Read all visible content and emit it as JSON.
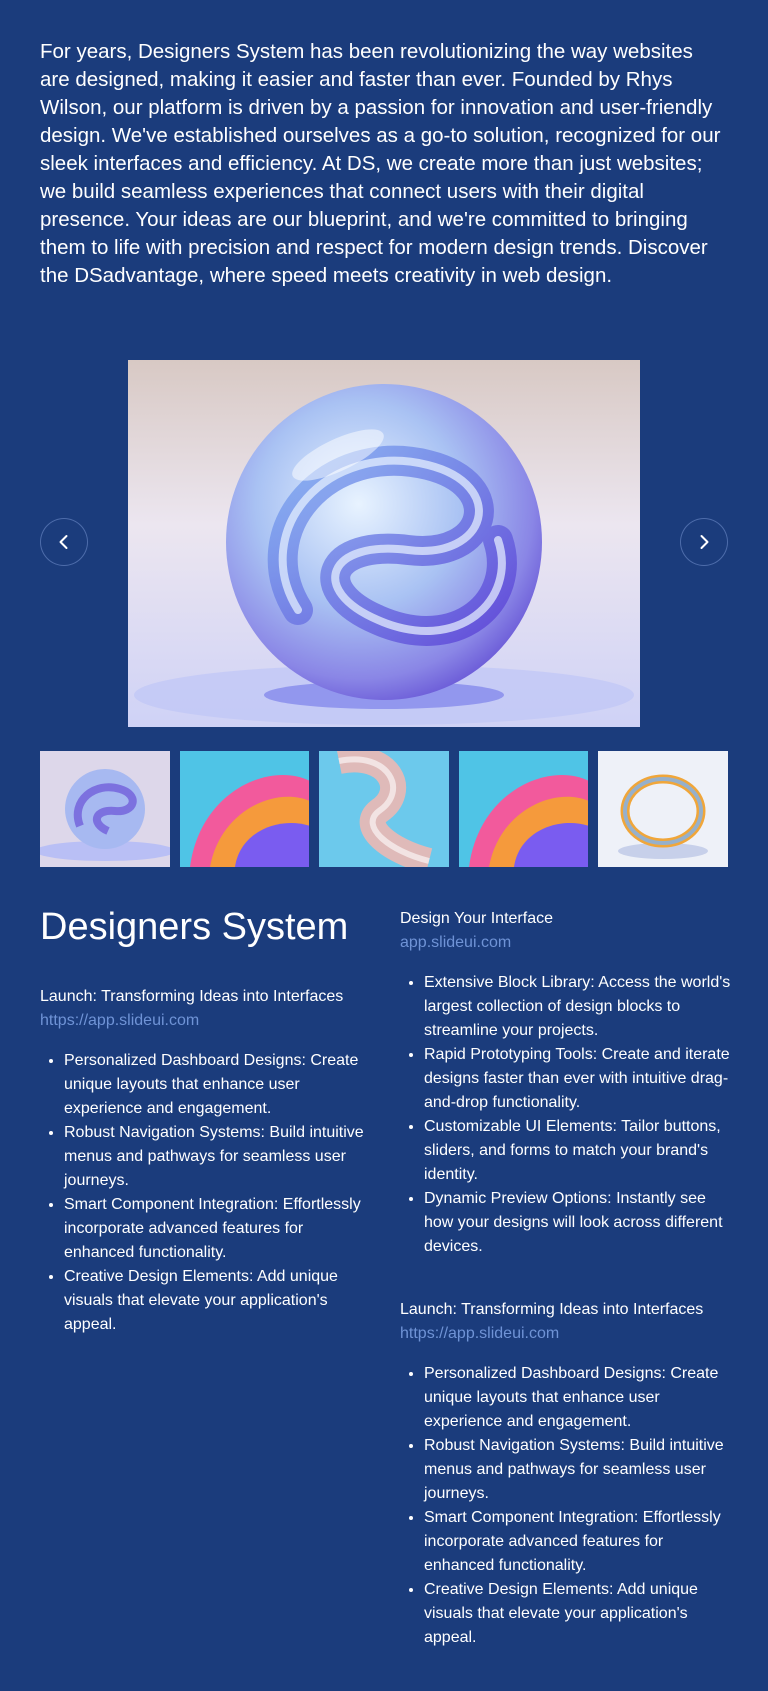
{
  "intro": {
    "text": "For years, Designers System has been revolutionizing the way websites are designed, making it easier and faster than ever. Founded by Rhys Wilson, our platform is driven by a passion for innovation and user-friendly design. We've established ourselves as a go-to solution, recognized for our sleek interfaces and efficiency. At DS, we create more than just websites; we build seamless experiences that connect users with their digital presence. Your ideas are our blueprint, and we're committed to bringing them to life with precision and respect for modern design trends. Discover the DSadvantage, where speed meets creativity in web design."
  },
  "gallery": {
    "prev_icon": "chevron-left-icon",
    "next_icon": "chevron-right-icon",
    "main_image": "glass-sphere-image",
    "thumbnails": [
      "glass-sphere-image",
      "rainbow-wave-image",
      "glass-ribbon-image",
      "rainbow-wave-image",
      "glass-ring-image"
    ]
  },
  "left": {
    "title": "Designers System",
    "block_title": "Launch: Transforming Ideas into Interfaces",
    "block_link": "https://app.slideui.com",
    "items": [
      "Personalized Dashboard Designs: Create unique layouts that enhance user experience and engagement.",
      "Robust Navigation Systems: Build intuitive menus and pathways for seamless user journeys.",
      "Smart Component Integration: Effortlessly incorporate advanced features for enhanced functionality.",
      "Creative Design Elements: Add unique visuals that elevate your application's appeal."
    ]
  },
  "right": {
    "block1_title": "Design Your Interface",
    "block1_link": "app.slideui.com",
    "block1_items": [
      "Extensive Block Library: Access the world's largest collection of design blocks to streamline your projects.",
      "Rapid Prototyping Tools: Create and iterate designs faster than ever with intuitive drag-and-drop functionality.",
      "Customizable UI Elements: Tailor buttons, sliders, and forms to match your brand's identity.",
      "Dynamic Preview Options: Instantly see how your designs will look across different devices."
    ],
    "block2_title": "Launch: Transforming Ideas into Interfaces",
    "block2_link": "https://app.slideui.com",
    "block2_items": [
      "Personalized Dashboard Designs: Create unique layouts that enhance user experience and engagement.",
      "Robust Navigation Systems: Build intuitive menus and pathways for seamless user journeys.",
      "Smart Component Integration: Effortlessly incorporate advanced features for enhanced functionality.",
      "Creative Design Elements: Add unique visuals that elevate your application's appeal."
    ]
  },
  "colors": {
    "background": "#1b3c7c",
    "link": "#6f93d6",
    "text": "#ffffff"
  }
}
